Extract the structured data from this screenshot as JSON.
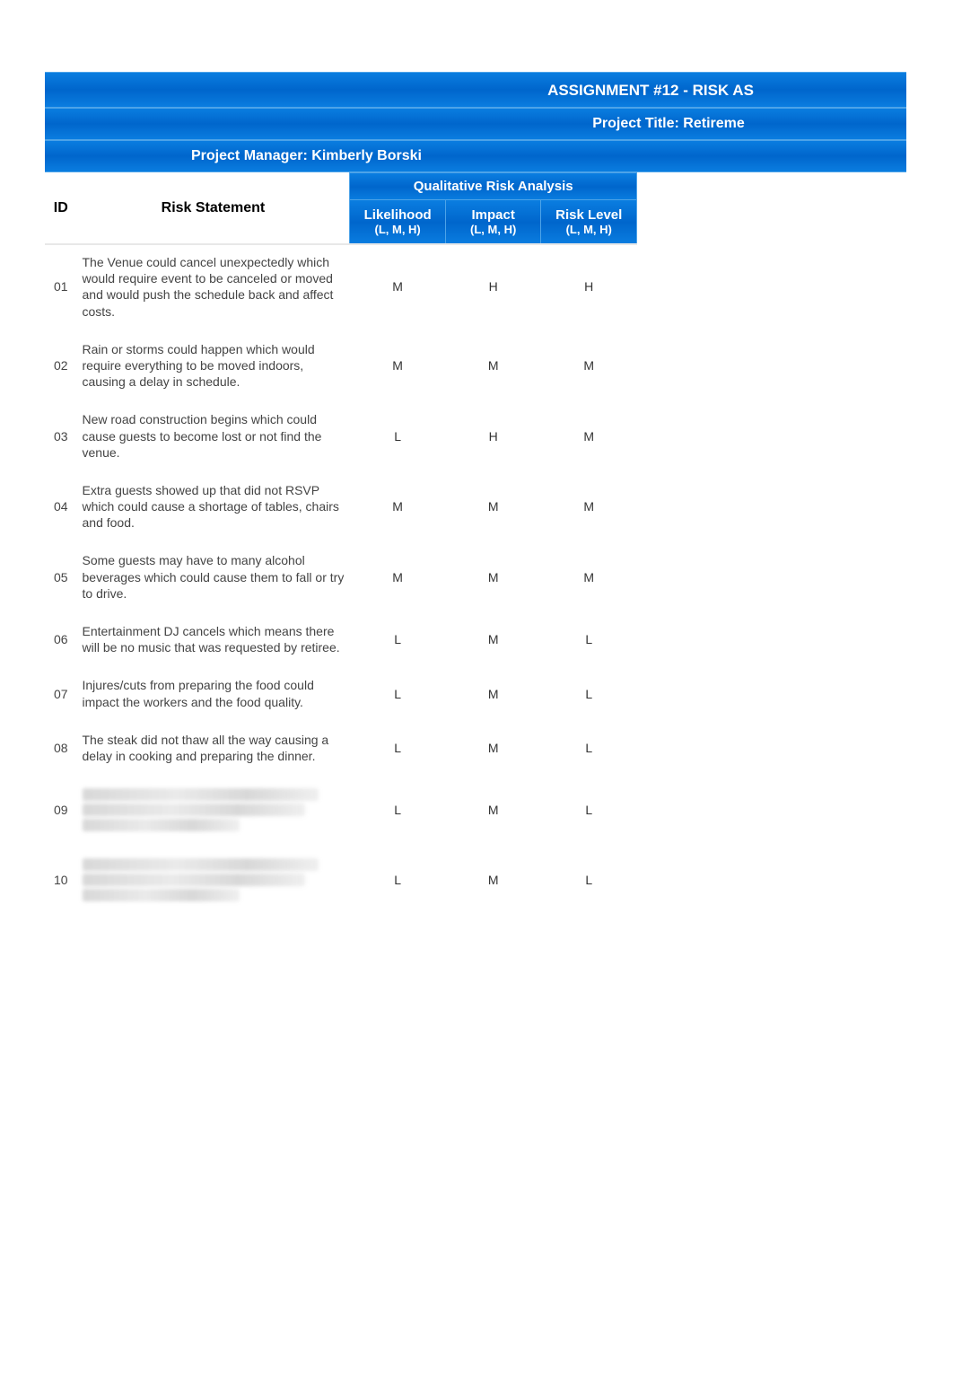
{
  "header": {
    "title": "ASSIGNMENT #12 - RISK AS",
    "project_title_label": "Project Title:  Retireme",
    "project_manager_label": "Project Manager:  Kimberly Borski"
  },
  "table": {
    "section_header": "Qualitative Risk Analysis",
    "columns": {
      "id": "ID",
      "risk_statement": "Risk Statement",
      "likelihood": "Likelihood",
      "likelihood_sub": "(L, M, H)",
      "impact": "Impact",
      "impact_sub": "(L, M, H)",
      "risk_level": "Risk Level",
      "risk_level_sub": "(L, M, H)"
    },
    "rows": [
      {
        "id": "01",
        "risk": "The Venue could cancel unexpectedly which would require event to be canceled or moved and would push the schedule back and affect costs.",
        "likelihood": "M",
        "impact": "H",
        "level": "H"
      },
      {
        "id": "02",
        "risk": "Rain or storms could happen which would require everything to be moved indoors, causing a delay in schedule.",
        "likelihood": "M",
        "impact": "M",
        "level": "M"
      },
      {
        "id": "03",
        "risk": "New road construction begins which could cause guests to become lost or not find the venue.",
        "likelihood": "L",
        "impact": "H",
        "level": "M"
      },
      {
        "id": "04",
        "risk": "Extra guests showed up that did not RSVP which could cause a shortage of tables, chairs and food.",
        "likelihood": "M",
        "impact": "M",
        "level": "M"
      },
      {
        "id": "05",
        "risk": "Some guests may have to many alcohol beverages which could cause them to fall or try to drive.",
        "likelihood": "M",
        "impact": "M",
        "level": "M"
      },
      {
        "id": "06",
        "risk": "Entertainment DJ cancels which means there will be no music that was requested by retiree.",
        "likelihood": "L",
        "impact": "M",
        "level": "L"
      },
      {
        "id": "07",
        "risk": "Injures/cuts from preparing the food could impact the workers and the food quality.",
        "likelihood": "L",
        "impact": "M",
        "level": "L"
      },
      {
        "id": "08",
        "risk": "The steak did not thaw all the way causing a delay in cooking and preparing the dinner.",
        "likelihood": "L",
        "impact": "M",
        "level": "L"
      },
      {
        "id": "09",
        "risk": "",
        "likelihood": "L",
        "impact": "M",
        "level": "L",
        "blurred": true
      },
      {
        "id": "10",
        "risk": "",
        "likelihood": "L",
        "impact": "M",
        "level": "L",
        "blurred": true
      }
    ]
  }
}
